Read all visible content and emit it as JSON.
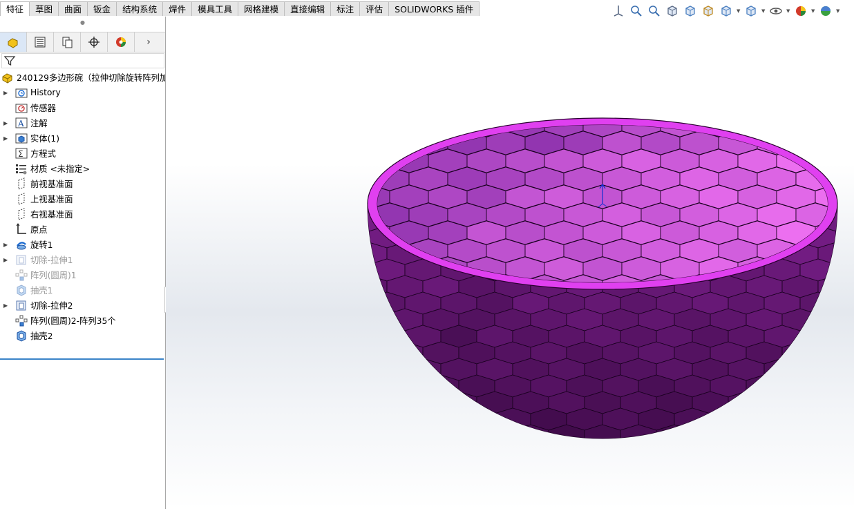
{
  "command_tabs": [
    "特征",
    "草图",
    "曲面",
    "钣金",
    "结构系统",
    "焊件",
    "模具工具",
    "网格建模",
    "直接编辑",
    "标注",
    "评估",
    "SOLIDWORKS 插件"
  ],
  "hud_icons": [
    "axis-icon",
    "zoom-to-fit-icon",
    "zoom-area-icon",
    "previous-view-icon",
    "section-view-icon",
    "dynamic-annotation-icon",
    "view-orientation-icon",
    "display-style-icon",
    "hide-show-icon",
    "edit-appearance-icon",
    "apply-scene-icon"
  ],
  "pane_tabs": [
    "featuremanager-icon",
    "propertymanager-icon",
    "configurationmanager-icon",
    "dimxpertmanager-icon",
    "displaymanager-icon"
  ],
  "tree": {
    "root": "240129多边形碗（拉伸切除旋转阵列加",
    "items": [
      {
        "label": "History",
        "icon": "history-folder-icon",
        "expand": true,
        "suppressed": false
      },
      {
        "label": "传感器",
        "icon": "sensors-folder-icon",
        "expand": false,
        "suppressed": false
      },
      {
        "label": "注解",
        "icon": "annotations-icon",
        "expand": true,
        "suppressed": false
      },
      {
        "label": "实体(1)",
        "icon": "solid-bodies-icon",
        "expand": true,
        "suppressed": false
      },
      {
        "label": "方程式",
        "icon": "equations-icon",
        "expand": false,
        "suppressed": false
      },
      {
        "label": "材质 <未指定>",
        "icon": "material-icon",
        "expand": false,
        "suppressed": false
      },
      {
        "label": "前视基准面",
        "icon": "plane-icon",
        "expand": false,
        "suppressed": false
      },
      {
        "label": "上视基准面",
        "icon": "plane-icon",
        "expand": false,
        "suppressed": false
      },
      {
        "label": "右视基准面",
        "icon": "plane-icon",
        "expand": false,
        "suppressed": false
      },
      {
        "label": "原点",
        "icon": "origin-icon",
        "expand": false,
        "suppressed": false
      },
      {
        "label": "旋转1",
        "icon": "revolve-icon",
        "expand": true,
        "suppressed": false
      },
      {
        "label": "切除-拉伸1",
        "icon": "cut-extrude-icon",
        "expand": true,
        "suppressed": true
      },
      {
        "label": "阵列(圆周)1",
        "icon": "circular-pattern-icon",
        "expand": false,
        "suppressed": true
      },
      {
        "label": "抽壳1",
        "icon": "shell-icon",
        "expand": false,
        "suppressed": true
      },
      {
        "label": "切除-拉伸2",
        "icon": "cut-extrude-icon",
        "expand": true,
        "suppressed": false
      },
      {
        "label": "阵列(圆周)2-阵列35个",
        "icon": "circular-pattern-icon",
        "expand": false,
        "suppressed": false
      },
      {
        "label": "抽壳2",
        "icon": "shell-icon",
        "expand": false,
        "suppressed": false
      }
    ]
  },
  "model": {
    "name": "faceted-bowl",
    "colors": {
      "dark": "#4a1250",
      "mid": "#8a30a8",
      "light": "#d060f0",
      "highlight": "#f090ff",
      "rim": "#e040f0"
    }
  }
}
